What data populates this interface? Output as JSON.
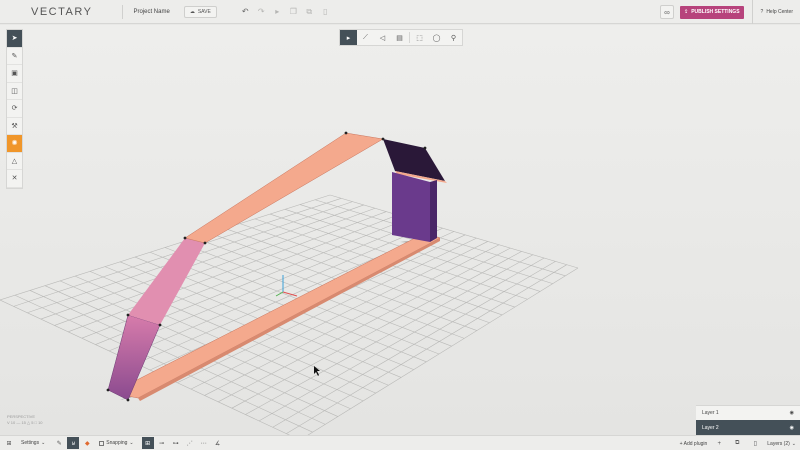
{
  "app": {
    "logo": "VECTARY",
    "project_name": "Project Name",
    "save_label": "SAVE"
  },
  "topbar": {
    "undo_icon": "undo-icon",
    "redo_icon": "redo-icon",
    "publish_label": "PUBLISH SETTINGS",
    "help_label": "Help Center",
    "accent": "#b7437c"
  },
  "viewport": {
    "view_label": "PERSPECTIVE",
    "stats": "V 10   — 15   △ 5   □ 10"
  },
  "layers": [
    {
      "name": "Layer 1",
      "active": false
    },
    {
      "name": "Layer 2",
      "active": true
    }
  ],
  "bottombar": {
    "settings_label": "Settings",
    "snapping_label": "Snapping",
    "add_plugin_label": "+ Add plugin",
    "layers_label": "Layers (2)"
  },
  "colors": {
    "shape_front": "#f4a98d",
    "shape_dark": "#5d3a7a",
    "toolbar_active": "#445058",
    "tool_orange": "#f0962a"
  }
}
